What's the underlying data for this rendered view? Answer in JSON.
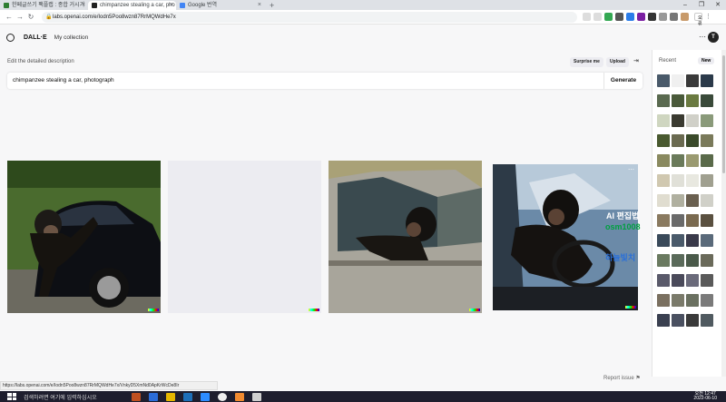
{
  "browser": {
    "tabs": [
      {
        "title": "한페글쓰기 팩플랩 : 종합 거시기",
        "favicon_color": "#2e7d32",
        "active": false
      },
      {
        "title": "chimpanzee stealing a car, pho",
        "favicon_color": "#222222",
        "active": true
      },
      {
        "title": "Google 번역",
        "favicon_color": "#4285f4",
        "active": false
      }
    ],
    "new_tab_glyph": "+",
    "url": "labs.openai.com/e/Iodn5Poo8wzn87RrMQWdHe7x",
    "profile_chip": "오류"
  },
  "app": {
    "brand": "DALL·E",
    "nav_my_collection": "My collection",
    "user_initial": "T",
    "more_icon": "⋯"
  },
  "editor": {
    "label": "Edit the detailed description",
    "surprise_label": "Surprise me",
    "upload_label": "Upload",
    "prompt_value": "chimpanzee stealing a car, photograph",
    "generate_label": "Generate"
  },
  "images": [
    {
      "alt": "generated-image-1"
    },
    {
      "alt": "generated-image-2-loading"
    },
    {
      "alt": "generated-image-3"
    },
    {
      "alt": "generated-image-4"
    }
  ],
  "watermark": {
    "line1": "AI 편집법",
    "line2": "osm1008",
    "line3": "하늘빛치"
  },
  "report_label": "Report issue",
  "sidebar": {
    "title": "Recent",
    "new_label": "New"
  },
  "status_url": "https://labs.openai.com/e/Iodn5Poo8wzn87RrMQWdHe7x/VnkyD5XmNd0ApKrWcDe8Ir",
  "taskbar": {
    "search_placeholder": "검색하려면 여기에 입력하십시오",
    "time": "오전 12:47",
    "date": "2022-06-10"
  },
  "colors": {
    "accent": "#10a37f",
    "page_bg": "#f7f7f8"
  }
}
